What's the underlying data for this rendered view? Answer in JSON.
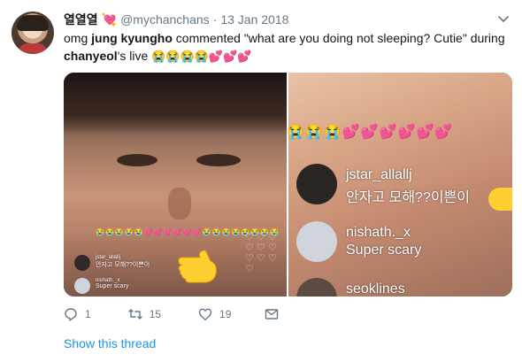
{
  "author": {
    "display_name": "열열열",
    "name_emoji": "💘",
    "handle": "@mychanchans",
    "separator": "·",
    "date": "13 Jan 2018"
  },
  "tweet": {
    "part1": "omg ",
    "bold1": "jung kyungho",
    "part2": " commented \"what are you doing not sleeping? Cutie\" during ",
    "bold2": "chanyeol",
    "part3": "'s live ",
    "emojis": "😭😭😭😭💕💕💕"
  },
  "media": {
    "small_emoji_row": "😭😭😭😭😭💕💕💕💕💕💕😭😭😭😭😭😭😭😭",
    "big_emoji_row": "😭😭😭💕💕💕💕💕💕",
    "small_comments": [
      {
        "name": "jstar_allallj",
        "text": "안자고 모해??이쁜이"
      },
      {
        "name": "nishath._x",
        "text": "Super scary"
      }
    ],
    "big_comments": [
      {
        "name": "jstar_allallj",
        "text": "안자고 모해??이쁜이"
      },
      {
        "name": "nishath._x",
        "text": "Super scary"
      },
      {
        "name": "seoklines",
        "text": ""
      }
    ],
    "hearts": "♡ ♡ ♡ ♡ ♡ ♡ ♡ ♡ ♡ ♡"
  },
  "actions": {
    "replies": "1",
    "retweets": "15",
    "likes": "19"
  },
  "show_thread": "Show this thread",
  "colors": {
    "link": "#1b95e0",
    "muted": "#657786",
    "text": "#14171a",
    "pointer": "#ffce31"
  },
  "icons": [
    "caret-down-icon",
    "reply-icon",
    "retweet-icon",
    "like-icon",
    "share-mail-icon",
    "pointing-hand-icon"
  ]
}
